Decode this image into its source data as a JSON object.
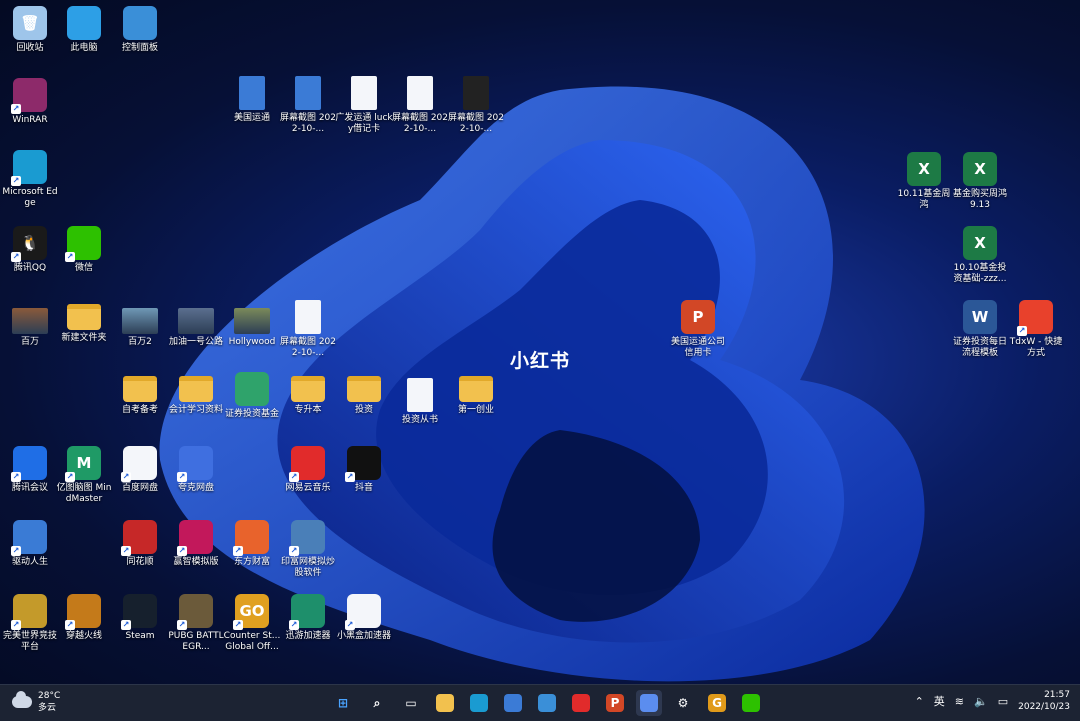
{
  "desktop": {
    "watermark": "小红书",
    "icons": [
      {
        "id": "recycle-bin",
        "label": "回收站",
        "icon": "recycle-bin-icon",
        "color": "#9ec5ea",
        "glyph": "🗑",
        "kind": "app",
        "shortcut": false
      },
      {
        "id": "this-pc",
        "label": "此电脑",
        "icon": "monitor-icon",
        "color": "#2d9fe6",
        "glyph": "",
        "kind": "app",
        "shortcut": false
      },
      {
        "id": "control-panel",
        "label": "控制面板",
        "icon": "control-panel-icon",
        "color": "#3a8fd8",
        "glyph": "",
        "kind": "app",
        "shortcut": false
      },
      {
        "id": "winrar",
        "label": "WinRAR",
        "icon": "winrar-icon",
        "color": "#8d2a6a",
        "glyph": "",
        "kind": "app",
        "shortcut": true
      },
      {
        "id": "edge",
        "label": "Microsoft Edge",
        "icon": "edge-icon",
        "color": "#1a9bd1",
        "glyph": "",
        "kind": "app",
        "shortcut": true
      },
      {
        "id": "qq",
        "label": "腾讯QQ",
        "icon": "qq-penguin-icon",
        "color": "#1a1a1a",
        "glyph": "🐧",
        "kind": "app",
        "shortcut": true
      },
      {
        "id": "wechat",
        "label": "微信",
        "icon": "wechat-icon",
        "color": "#2dc100",
        "glyph": "",
        "kind": "app",
        "shortcut": true
      },
      {
        "id": "baiwan",
        "label": "百万",
        "icon": "image-icon",
        "color": "#8a5a3a",
        "glyph": "",
        "kind": "img",
        "shortcut": false
      },
      {
        "id": "new-folder",
        "label": "新建文件夹",
        "icon": "folder-icon",
        "color": "#f2c14e",
        "glyph": "",
        "kind": "folder",
        "shortcut": false
      },
      {
        "id": "baiwan2",
        "label": "百万2",
        "icon": "image-icon",
        "color": "#6f98b6",
        "glyph": "",
        "kind": "img",
        "shortcut": false
      },
      {
        "id": "jiayou",
        "label": "加油一号公路",
        "icon": "image-icon",
        "color": "#5b6f8f",
        "glyph": "",
        "kind": "img",
        "shortcut": false
      },
      {
        "id": "hollywood",
        "label": "Hollywood",
        "icon": "image-icon",
        "color": "#7b8a5a",
        "glyph": "",
        "kind": "img",
        "shortcut": false
      },
      {
        "id": "screenshot-a",
        "label": "屏幕截图 2022-10-...",
        "icon": "document-icon",
        "color": "#f4f6fa",
        "glyph": "",
        "kind": "doc",
        "shortcut": false
      },
      {
        "id": "meiguo-yuntong",
        "label": "美国运通",
        "icon": "document-icon",
        "color": "#3b7bd6",
        "glyph": "",
        "kind": "doc",
        "shortcut": false
      },
      {
        "id": "screenshot-b",
        "label": "屏幕截图 2022-10-...",
        "icon": "document-icon",
        "color": "#3b7bd6",
        "glyph": "",
        "kind": "doc",
        "shortcut": false
      },
      {
        "id": "guangfa",
        "label": "广发运通 lucky借记卡",
        "icon": "document-icon",
        "color": "#f4f6fa",
        "glyph": "",
        "kind": "doc",
        "shortcut": false
      },
      {
        "id": "screenshot-c",
        "label": "屏幕截图 2022-10-...",
        "icon": "document-icon",
        "color": "#f4f6fa",
        "glyph": "",
        "kind": "doc",
        "shortcut": false
      },
      {
        "id": "screenshot-d",
        "label": "屏幕截图 2022-10-...",
        "icon": "document-icon",
        "color": "#222",
        "glyph": "",
        "kind": "doc",
        "shortcut": false
      },
      {
        "id": "excel-1011",
        "label": "10.11基金周 鸿",
        "icon": "excel-icon",
        "color": "#1d7a45",
        "glyph": "X",
        "kind": "app",
        "shortcut": false
      },
      {
        "id": "excel-913",
        "label": "基金购买周鸿 9.13",
        "icon": "excel-icon",
        "color": "#1d7a45",
        "glyph": "X",
        "kind": "app",
        "shortcut": false
      },
      {
        "id": "excel-1010",
        "label": "10.10基金投 资基础-zzz...",
        "icon": "excel-icon",
        "color": "#1d7a45",
        "glyph": "X",
        "kind": "app",
        "shortcut": false
      },
      {
        "id": "ppt-amex",
        "label": "美国运通公司 信用卡",
        "icon": "powerpoint-icon",
        "color": "#d24726",
        "glyph": "P",
        "kind": "app",
        "shortcut": false
      },
      {
        "id": "word-zq",
        "label": "证券投资每日 流程模板",
        "icon": "word-icon",
        "color": "#2b5797",
        "glyph": "W",
        "kind": "app",
        "shortcut": false
      },
      {
        "id": "tdxw",
        "label": "TdxW - 快捷 方式",
        "icon": "tdx-icon",
        "color": "#e8412c",
        "glyph": "",
        "kind": "app",
        "shortcut": true
      },
      {
        "id": "zikao",
        "label": "自考备考",
        "icon": "folder-icon",
        "color": "#f2c14e",
        "glyph": "",
        "kind": "folder",
        "shortcut": false
      },
      {
        "id": "kuaiji",
        "label": "会计学习资料",
        "icon": "folder-icon",
        "color": "#f2c14e",
        "glyph": "",
        "kind": "folder",
        "shortcut": false
      },
      {
        "id": "zhengquan",
        "label": "证券投资基金",
        "icon": "mindmap-icon",
        "color": "#2fa36b",
        "glyph": "",
        "kind": "app",
        "shortcut": false
      },
      {
        "id": "zhuanke",
        "label": "专升本",
        "icon": "folder-icon",
        "color": "#f2c14e",
        "glyph": "",
        "kind": "folder",
        "shortcut": false
      },
      {
        "id": "touzi",
        "label": "投资",
        "icon": "folder-icon",
        "color": "#f2c14e",
        "glyph": "",
        "kind": "folder",
        "shortcut": false
      },
      {
        "id": "touzi-book",
        "label": "投资从书",
        "icon": "document-icon",
        "color": "#f4f6fa",
        "glyph": "",
        "kind": "doc",
        "shortcut": false
      },
      {
        "id": "diyi",
        "label": "第一创业",
        "icon": "folder-icon",
        "color": "#f2c14e",
        "glyph": "",
        "kind": "folder",
        "shortcut": false
      },
      {
        "id": "tencent-meeting",
        "label": "腾讯会议",
        "icon": "tencent-meeting-icon",
        "color": "#1f6ee6",
        "glyph": "",
        "kind": "app",
        "shortcut": true
      },
      {
        "id": "mindmaster",
        "label": "亿图脑图 MindMaster",
        "icon": "mindmaster-icon",
        "color": "#1f9a66",
        "glyph": "M",
        "kind": "app",
        "shortcut": true
      },
      {
        "id": "baidu-pan",
        "label": "百度网盘",
        "icon": "baidu-netdisk-icon",
        "color": "#f4f6fa",
        "glyph": "",
        "kind": "app",
        "shortcut": true
      },
      {
        "id": "kuake",
        "label": "夸克网盘",
        "icon": "quark-cloud-icon",
        "color": "#3f6fe0",
        "glyph": "",
        "kind": "app",
        "shortcut": true
      },
      {
        "id": "netease-music",
        "label": "网易云音乐",
        "icon": "netease-music-icon",
        "color": "#e12b2b",
        "glyph": "",
        "kind": "app",
        "shortcut": true
      },
      {
        "id": "douyin",
        "label": "抖音",
        "icon": "tiktok-icon",
        "color": "#111",
        "glyph": "",
        "kind": "app",
        "shortcut": true
      },
      {
        "id": "qudong",
        "label": "驱动人生",
        "icon": "driver-gear-icon",
        "color": "#3a7bd5",
        "glyph": "",
        "kind": "app",
        "shortcut": true
      },
      {
        "id": "tonghuashun",
        "label": "同花顺",
        "icon": "cards-icon",
        "color": "#c62828",
        "glyph": "",
        "kind": "app",
        "shortcut": true
      },
      {
        "id": "wh8",
        "label": "赢智模拟版",
        "icon": "wh8-icon",
        "color": "#c2185b",
        "glyph": "",
        "kind": "app",
        "shortcut": true
      },
      {
        "id": "dongfang",
        "label": "东方财富",
        "icon": "eastmoney-icon",
        "color": "#e8632c",
        "glyph": "",
        "kind": "app",
        "shortcut": true
      },
      {
        "id": "yinfu",
        "label": "印富网模拟炒 股软件",
        "icon": "stock-chart-icon",
        "color": "#4a7fb8",
        "glyph": "",
        "kind": "app",
        "shortcut": true
      },
      {
        "id": "wanmei",
        "label": "完美世界竞技 平台",
        "icon": "wanmei-icon",
        "color": "#c49a2a",
        "glyph": "",
        "kind": "app",
        "shortcut": true
      },
      {
        "id": "chuanyue",
        "label": "穿越火线",
        "icon": "crossfire-icon",
        "color": "#c47a1a",
        "glyph": "",
        "kind": "app",
        "shortcut": true
      },
      {
        "id": "steam",
        "label": "Steam",
        "icon": "steam-icon",
        "color": "#16202d",
        "glyph": "",
        "kind": "app",
        "shortcut": true
      },
      {
        "id": "pubg",
        "label": "PUBG BATTLEGR...",
        "icon": "pubg-icon",
        "color": "#6b5a3a",
        "glyph": "",
        "kind": "app",
        "shortcut": true
      },
      {
        "id": "csgo",
        "label": "Counter St... Global Off...",
        "icon": "csgo-icon",
        "color": "#e0a020",
        "glyph": "GO",
        "kind": "app",
        "shortcut": true
      },
      {
        "id": "xunyou",
        "label": "迅游加速器",
        "icon": "xunyou-icon",
        "color": "#1e8f6b",
        "glyph": "",
        "kind": "app",
        "shortcut": true
      },
      {
        "id": "xiaohei",
        "label": "小黑盒加速器",
        "icon": "xiaoheihe-icon",
        "color": "#f4f6fa",
        "glyph": "",
        "kind": "app",
        "shortcut": true
      }
    ]
  },
  "taskbar": {
    "weather": {
      "temp": "28°C",
      "condition": "多云",
      "icon": "cloud-icon"
    },
    "apps": [
      {
        "id": "start",
        "icon": "windows-start-icon",
        "glyph": "⊞",
        "active": false
      },
      {
        "id": "search",
        "icon": "search-icon",
        "glyph": "⌕",
        "active": false
      },
      {
        "id": "task-view",
        "icon": "task-view-icon",
        "glyph": "▭",
        "active": false
      },
      {
        "id": "file-explorer",
        "icon": "folder-icon",
        "glyph": "",
        "active": false
      },
      {
        "id": "edge",
        "icon": "edge-icon",
        "glyph": "",
        "active": false
      },
      {
        "id": "store",
        "icon": "store-icon",
        "glyph": "",
        "active": false
      },
      {
        "id": "photos",
        "icon": "photos-icon",
        "glyph": "",
        "active": false
      },
      {
        "id": "netease-music",
        "icon": "netease-music-icon",
        "glyph": "",
        "active": false
      },
      {
        "id": "powerpoint",
        "icon": "powerpoint-icon",
        "glyph": "P",
        "active": false
      },
      {
        "id": "snipping",
        "icon": "snipping-tool-icon",
        "glyph": "",
        "active": true
      },
      {
        "id": "settings",
        "icon": "gear-icon",
        "glyph": "⚙",
        "active": false
      },
      {
        "id": "app-g",
        "icon": "g-app-icon",
        "glyph": "G",
        "active": false
      },
      {
        "id": "wechat",
        "icon": "wechat-icon",
        "glyph": "",
        "active": false
      }
    ],
    "tray": {
      "ime": "英",
      "time": "21:57",
      "date": "2022/10/23"
    }
  },
  "colors": {
    "taskbar_bg": "#1c2333",
    "wallpaper_accent": "#1b3aa8"
  }
}
